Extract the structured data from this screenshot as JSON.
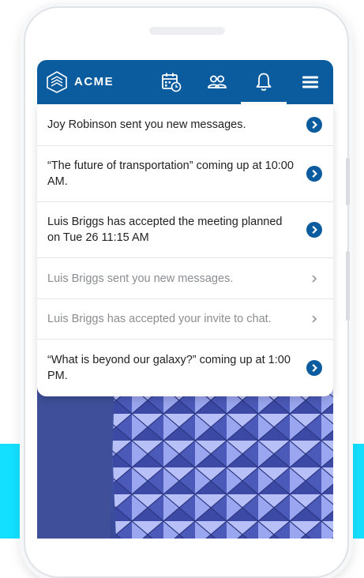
{
  "brand": {
    "name": "ACME"
  },
  "nav": [
    {
      "name": "calendar-icon",
      "active": false
    },
    {
      "name": "people-icon",
      "active": false
    },
    {
      "name": "bell-icon",
      "active": true
    },
    {
      "name": "menu-icon",
      "active": false
    }
  ],
  "notifications": [
    {
      "text": "Joy Robinson sent you new messages.",
      "unread": true
    },
    {
      "text": "“The future of transportation” coming up at 10:00 AM.",
      "unread": true
    },
    {
      "text": "Luis Briggs has accepted the meeting planned on Tue 26 11:15 AM",
      "unread": true
    },
    {
      "text": "Luis Briggs sent you new messages.",
      "unread": false
    },
    {
      "text": "Luis Briggs has accepted your invite to chat.",
      "unread": false
    },
    {
      "text": "“What is beyond our galaxy?” coming up at 1:00 PM.",
      "unread": true
    }
  ],
  "colors": {
    "header": "#0b5c9e",
    "accent": "#0b5c9e",
    "background_band": "#13e0ff",
    "read_text": "#8a8d91"
  }
}
